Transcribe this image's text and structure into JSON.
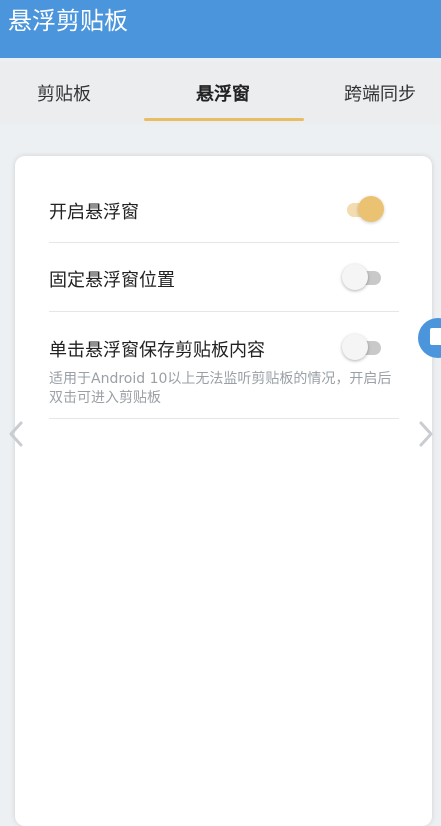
{
  "app": {
    "title": "悬浮剪贴板",
    "accent_color": "#4a95dc",
    "highlight_color": "#eac271"
  },
  "tabs": [
    {
      "label": "剪贴板",
      "selected": false
    },
    {
      "label": "悬浮窗",
      "selected": true
    },
    {
      "label": "跨端同步",
      "selected": false
    }
  ],
  "settings": {
    "items": [
      {
        "label": "开启悬浮窗",
        "enabled": true
      },
      {
        "label": "固定悬浮窗位置",
        "enabled": false
      },
      {
        "label": "单击悬浮窗保存剪贴板内容",
        "enabled": false,
        "description": "适用于Android 10以上无法监听剪贴板的情况，开启后双击可进入剪贴板"
      }
    ]
  },
  "icons": {
    "left": "chevron-left-icon",
    "right": "chevron-right-icon",
    "floating": "clipboard-icon"
  }
}
